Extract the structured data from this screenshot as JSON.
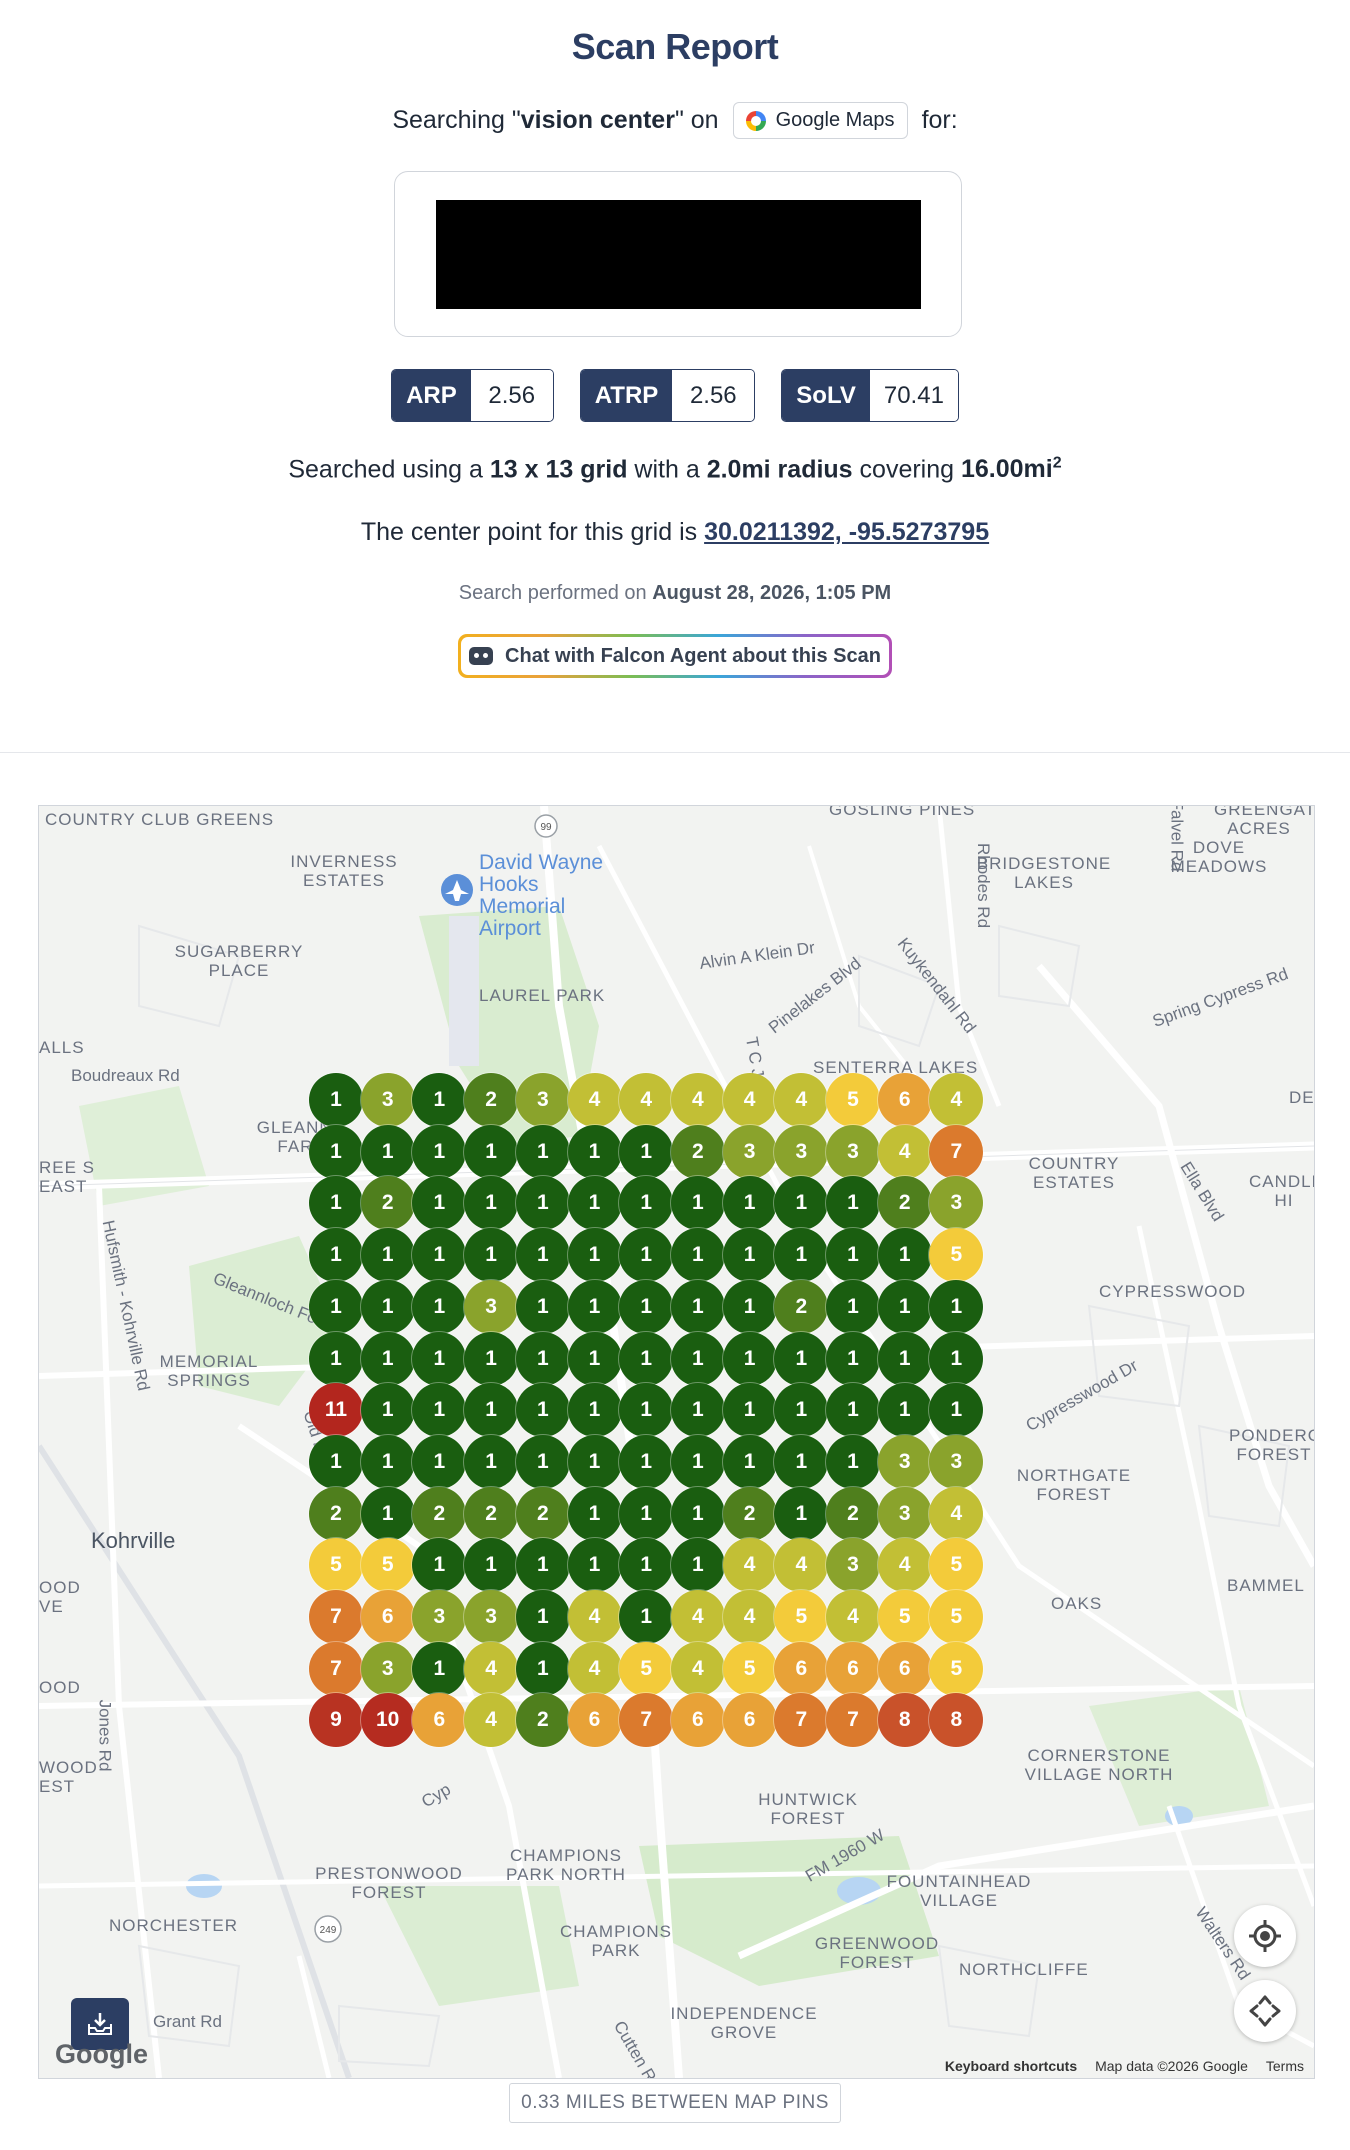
{
  "header": {
    "title": "Scan Report",
    "search_prefix": "Searching \"",
    "keyword": "vision center",
    "search_mid": "\" on",
    "platform": "Google Maps",
    "search_suffix": "for:"
  },
  "metrics": [
    {
      "label": "ARP",
      "value": "2.56"
    },
    {
      "label": "ATRP",
      "value": "2.56"
    },
    {
      "label": "SoLV",
      "value": "70.41"
    }
  ],
  "grid_info": {
    "prefix": "Searched using a",
    "grid_size": "13 x 13 grid",
    "mid1": "with a",
    "radius": "2.0mi radius",
    "mid2": "covering",
    "area": "16.00mi",
    "area_sup": "2"
  },
  "center": {
    "prefix": "The center point for this grid is",
    "coords": "30.0211392, -95.5273795"
  },
  "performed": {
    "prefix": "Search performed on",
    "date": "August 28, 2026, 1:05 PM"
  },
  "chat_button": {
    "label": "Chat with Falcon Agent about this Scan"
  },
  "map": {
    "labels": [
      "COUNTRY CLUB GREENS",
      "INVERNESS ESTATES",
      "David Wayne Hooks Memorial Airport",
      "GOSLING PINES",
      "BRIDGESTONE LAKES",
      "GREENGATE ACRES",
      "DOVE MEADOWS",
      "SUGARBERRY PLACE",
      "LAUREL PARK",
      "Alvin A Klein Dr",
      "Pinelakes Blvd",
      "Kuykendahl Rd",
      "Spring Cypress Rd",
      "SENTERRA LAKES",
      "Boudreaux Rd",
      "GLEANN'S FARM",
      "COUNTRY ESTATES",
      "CANDLE HI",
      "Ella Blvd",
      "Hufsmith - Kohrville Rd",
      "MEMORIAL SPRINGS",
      "CYPRESSWOOD",
      "Cypresswood Dr",
      "PONDEROSA FOREST",
      "NORTHGATE FOREST",
      "Kohrville",
      "Old Louetta Rd",
      "BAMMEL",
      "OAKS",
      "CORNERSTONE VILLAGE NORTH",
      "HUNTWICK FOREST",
      "Jones Rd",
      "PRESTONWOOD FOREST",
      "CHAMPIONS PARK NORTH",
      "FOUNTAINHEAD VILLAGE",
      "FM 1960 W",
      "NORCHESTER",
      "CHAMPIONS PARK",
      "GREENWOOD FOREST",
      "NORTHCLIFFE",
      "INDEPENDENCE GROVE",
      "Grant Rd",
      "Walters Rd",
      "Gleannloch Forest",
      "Rhodes Rd",
      "Falvel Rd",
      "ALLS",
      "REE S EAST",
      "OOD VE",
      "OOD",
      "WOOD EST",
      "DE",
      "Cutten Rd",
      "T C Jester",
      "Cyp"
    ],
    "grid_values": [
      [
        1,
        3,
        1,
        2,
        3,
        4,
        4,
        4,
        4,
        4,
        5,
        6,
        4
      ],
      [
        1,
        1,
        1,
        1,
        1,
        1,
        1,
        2,
        3,
        3,
        3,
        4,
        7
      ],
      [
        1,
        2,
        1,
        1,
        1,
        1,
        1,
        1,
        1,
        1,
        1,
        2,
        3
      ],
      [
        1,
        1,
        1,
        1,
        1,
        1,
        1,
        1,
        1,
        1,
        1,
        1,
        5
      ],
      [
        1,
        1,
        1,
        3,
        1,
        1,
        1,
        1,
        1,
        2,
        1,
        1,
        1
      ],
      [
        1,
        1,
        1,
        1,
        1,
        1,
        1,
        1,
        1,
        1,
        1,
        1,
        1
      ],
      [
        11,
        1,
        1,
        1,
        1,
        1,
        1,
        1,
        1,
        1,
        1,
        1,
        1
      ],
      [
        1,
        1,
        1,
        1,
        1,
        1,
        1,
        1,
        1,
        1,
        1,
        3,
        3
      ],
      [
        2,
        1,
        2,
        2,
        2,
        1,
        1,
        1,
        2,
        1,
        2,
        3,
        4
      ],
      [
        5,
        5,
        1,
        1,
        1,
        1,
        1,
        1,
        4,
        4,
        3,
        4,
        5
      ],
      [
        7,
        6,
        3,
        3,
        1,
        4,
        1,
        4,
        4,
        5,
        4,
        5,
        5
      ],
      [
        7,
        3,
        1,
        4,
        1,
        4,
        5,
        4,
        5,
        6,
        6,
        6,
        5
      ],
      [
        9,
        10,
        6,
        4,
        2,
        6,
        7,
        6,
        6,
        7,
        7,
        8,
        8
      ]
    ],
    "rank_colors": {
      "1": "#1a5e10",
      "2": "#4f7f1d",
      "3": "#8aa32c",
      "4": "#c2bf35",
      "5": "#f3cb3a",
      "6": "#e8a237",
      "7": "#db7a2d",
      "8": "#c9522a",
      "9": "#b83322",
      "10": "#b52c20",
      "11": "#b3261e"
    },
    "google_logo": "Google",
    "attribution": {
      "shortcuts": "Keyboard shortcuts",
      "data": "Map data ©2026 Google",
      "terms": "Terms"
    },
    "icons": [
      "crosshair-icon",
      "pan-icon",
      "download-icon"
    ]
  },
  "distance_label": "0.33 MILES BETWEEN MAP PINS"
}
